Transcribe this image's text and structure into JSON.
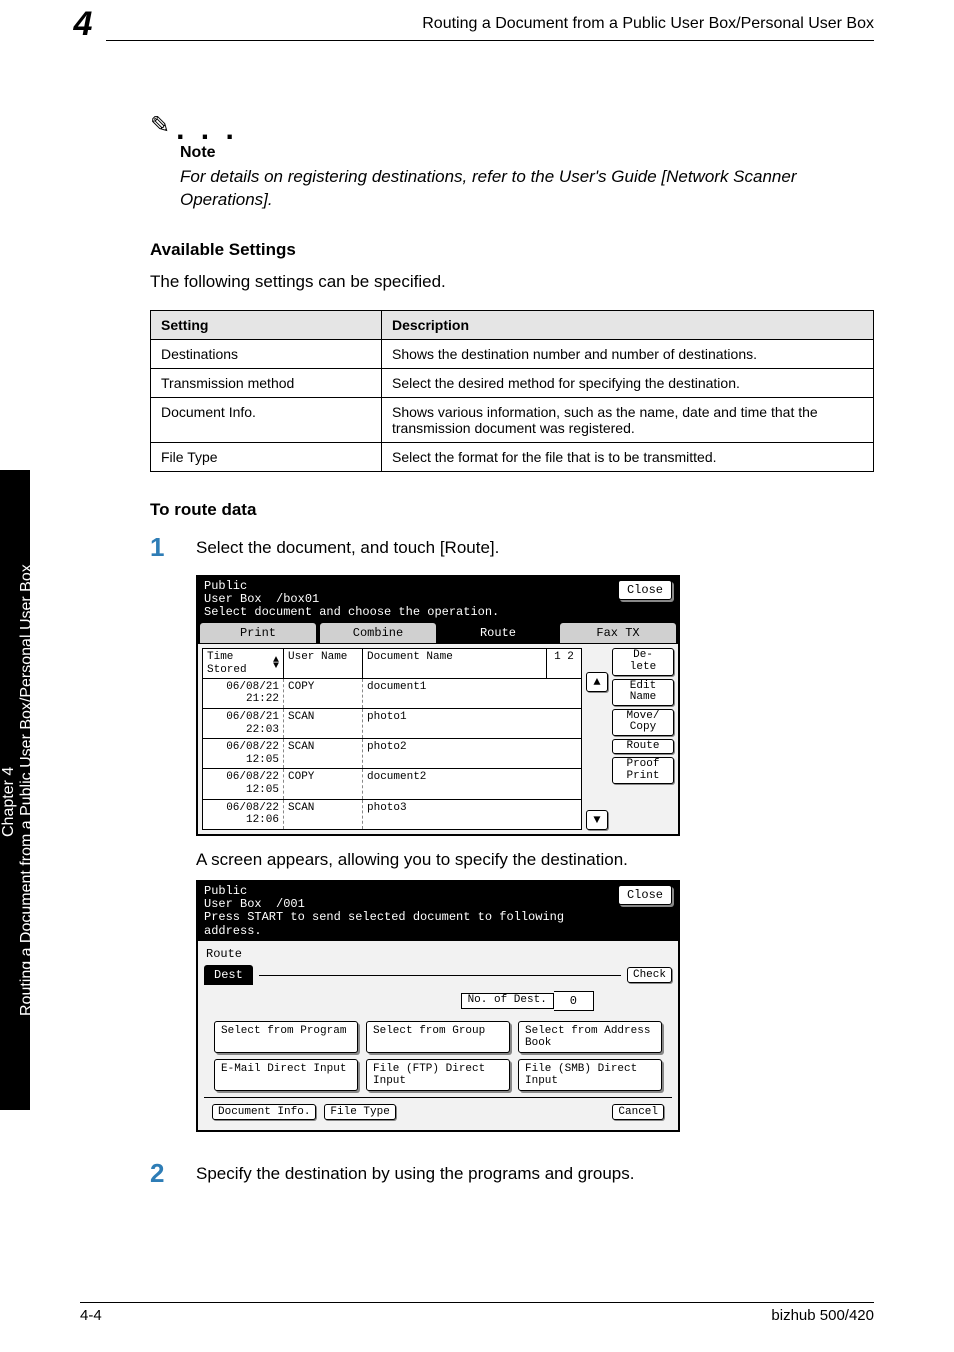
{
  "header": {
    "chapter_number": "4",
    "running_title": "Routing a Document from a Public User Box/Personal User Box"
  },
  "sidetab": {
    "chapter_label": "Chapter 4",
    "section_label": "Routing a Document from a Public User Box/Personal User Box"
  },
  "note": {
    "label": "Note",
    "text": "For details on registering destinations, refer to the User's Guide [Network Scanner Operations]."
  },
  "section_available": {
    "heading": "Available Settings",
    "intro": "The following settings can be specified."
  },
  "settings_table": {
    "cols": [
      "Setting",
      "Description"
    ],
    "rows": [
      [
        "Destinations",
        "Shows the destination number and number of destinations."
      ],
      [
        "Transmission method",
        "Select the desired method for specifying the destination."
      ],
      [
        "Document Info.",
        "Shows various information, such as the name, date and time that the transmission document was registered."
      ],
      [
        "File Type",
        "Select the format for the file that is to be transmitted."
      ]
    ]
  },
  "section_route": {
    "heading": "To route data"
  },
  "steps": {
    "s1_num": "1",
    "s1_text": "Select the document, and touch [Route].",
    "between": "A screen appears, allowing you to specify the destination.",
    "s2_num": "2",
    "s2_text": "Specify the destination by using the programs and groups."
  },
  "lcd1": {
    "title_line1": "Public",
    "title_line2": "User Box",
    "box_id": "/box01",
    "instruction": "Select document and choose the operation.",
    "close": "Close",
    "tabs": [
      "Print",
      "Combine",
      "Route",
      "Fax TX"
    ],
    "hdr": {
      "c1": "Time Stored",
      "c2": "User Name",
      "c3": "Document Name",
      "c4": "1 2"
    },
    "rows": [
      {
        "time": "06/08/21 21:22",
        "user": "COPY",
        "doc": "document1"
      },
      {
        "time": "06/08/21 22:03",
        "user": "SCAN",
        "doc": "photo1"
      },
      {
        "time": "06/08/22 12:05",
        "user": "SCAN",
        "doc": "photo2"
      },
      {
        "time": "06/08/22 12:05",
        "user": "COPY",
        "doc": "document2"
      },
      {
        "time": "06/08/22 12:06",
        "user": "SCAN",
        "doc": "photo3"
      }
    ],
    "side": [
      "De- lete",
      "Edit Name",
      "Move/ Copy",
      "Route",
      "Proof Print"
    ],
    "scroll_up": "▲",
    "scroll_down": "▼"
  },
  "lcd2": {
    "title_line1": "Public",
    "title_line2": "User Box",
    "box_id": "/001",
    "instruction": "Press START to send selected document to following address.",
    "close": "Close",
    "route_label": "Route",
    "dest_label": "Dest",
    "check": "Check",
    "count_label": "No. of Dest.",
    "count_value": "0",
    "row1": [
      "Select from Program",
      "Select from Group",
      "Select from Address Book"
    ],
    "row2": [
      "E-Mail Direct Input",
      "File (FTP) Direct Input",
      "File (SMB) Direct Input"
    ],
    "doc_info": "Document Info.",
    "file_type": "File Type",
    "cancel": "Cancel"
  },
  "footer": {
    "left": "4-4",
    "right": "bizhub 500/420"
  }
}
